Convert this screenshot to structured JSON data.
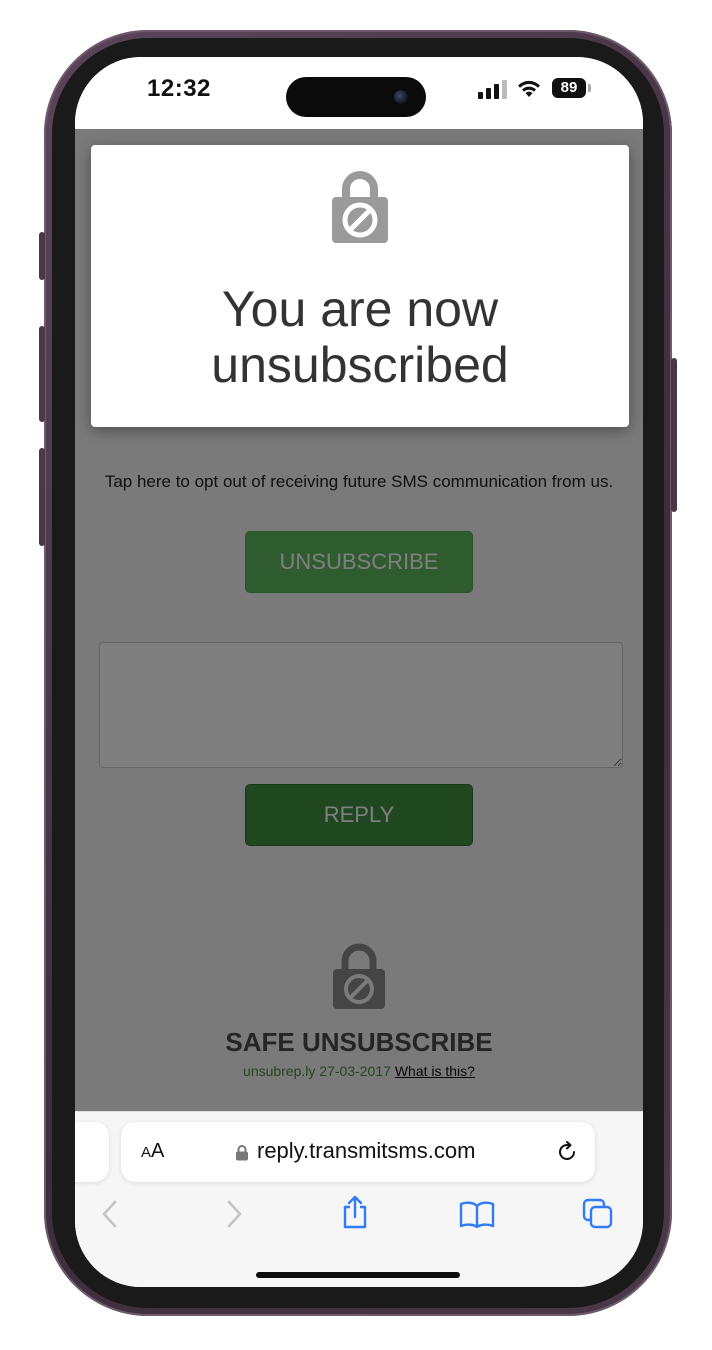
{
  "status_bar": {
    "time": "12:32",
    "battery": "89"
  },
  "page": {
    "modal": {
      "lock_icon": "lock-blocked-icon",
      "message_line1": "You are now",
      "message_line2": "unsubscribed"
    },
    "opt_out_text": "Tap here to opt out of receiving future SMS communication from us.",
    "unsubscribe_button": "UNSUBSCRIBE",
    "reply_placeholder": "",
    "reply_button": "REPLY",
    "footer": {
      "lock_icon": "lock-blocked-icon",
      "title": "SAFE UNSUBSCRIBE",
      "brand": "unsubrep.ly 27-03-2017",
      "link": "What is this?"
    }
  },
  "browser": {
    "text_size_label_small": "A",
    "text_size_label_large": "A",
    "url": "reply.transmitsms.com",
    "toolbar": [
      "back-icon",
      "forward-icon",
      "share-icon",
      "bookmarks-icon",
      "tabs-icon"
    ]
  },
  "colors": {
    "unsubscribe_green": "#5cb85c",
    "reply_green": "#3e8e41",
    "ios_blue": "#2f7cf6",
    "frame_purple": "#4a3a48"
  }
}
